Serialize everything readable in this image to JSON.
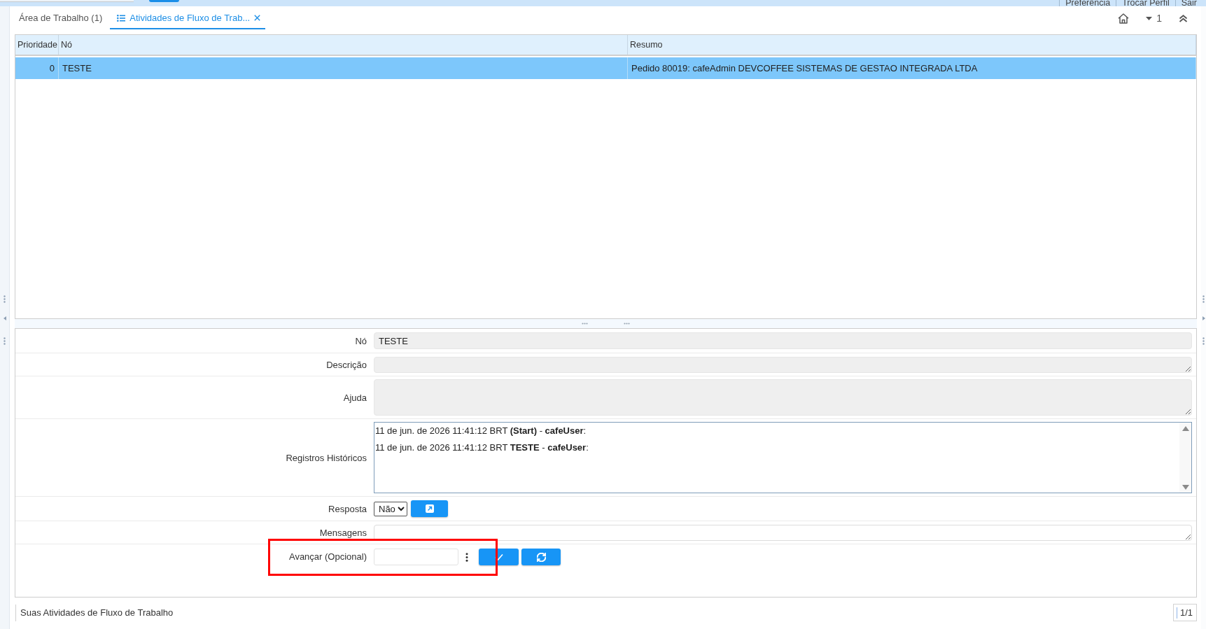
{
  "header": {
    "links": [
      "Preferência",
      "Trocar Perfil",
      "Sair"
    ]
  },
  "tabs": [
    {
      "label": "Área de Trabalho (1)",
      "selected": false,
      "has_icon": false,
      "closable": false
    },
    {
      "label": "Atividades de Fluxo de Trab...",
      "selected": true,
      "has_icon": true,
      "closable": true
    }
  ],
  "toolbar": {
    "menu_count": "1"
  },
  "grid": {
    "columns": [
      "Prioridade",
      "Nó",
      "Resumo"
    ],
    "rows": [
      {
        "cells": [
          "0",
          "TESTE",
          "Pedido 80019: cafeAdmin DEVCOFFEE SISTEMAS DE GESTAO INTEGRADA LTDA"
        ],
        "selected": true
      }
    ]
  },
  "form": {
    "fields": [
      {
        "kind": "text",
        "label": "Nó",
        "value": "TESTE",
        "readonly": true,
        "highlighted": false
      },
      {
        "kind": "textarea",
        "label": "Descrição",
        "readonly": true,
        "highlighted": false
      },
      {
        "kind": "memo",
        "label": "Ajuda",
        "readonly": true,
        "highlighted": false
      },
      {
        "kind": "history",
        "label": "Registros Históricos",
        "entries": [
          "11 de jun. de 2026 11:41:12 BRT **(Start)** - **cafeUser**:",
          "11 de jun. de 2026 11:41:12 BRT **TESTE** - **cafeUser**:"
        ],
        "highlighted": false
      },
      {
        "kind": "choice",
        "label": "Resposta",
        "value": "Não",
        "highlighted": false
      },
      {
        "kind": "textarea",
        "label": "Mensagens",
        "readonly": false,
        "highlighted": false
      },
      {
        "kind": "advance",
        "label": "Avançar (Opcional)",
        "highlighted": true
      }
    ]
  },
  "status_bar": {
    "title": "Suas Atividades de Fluxo de Trabalho",
    "pager": "1/1"
  }
}
